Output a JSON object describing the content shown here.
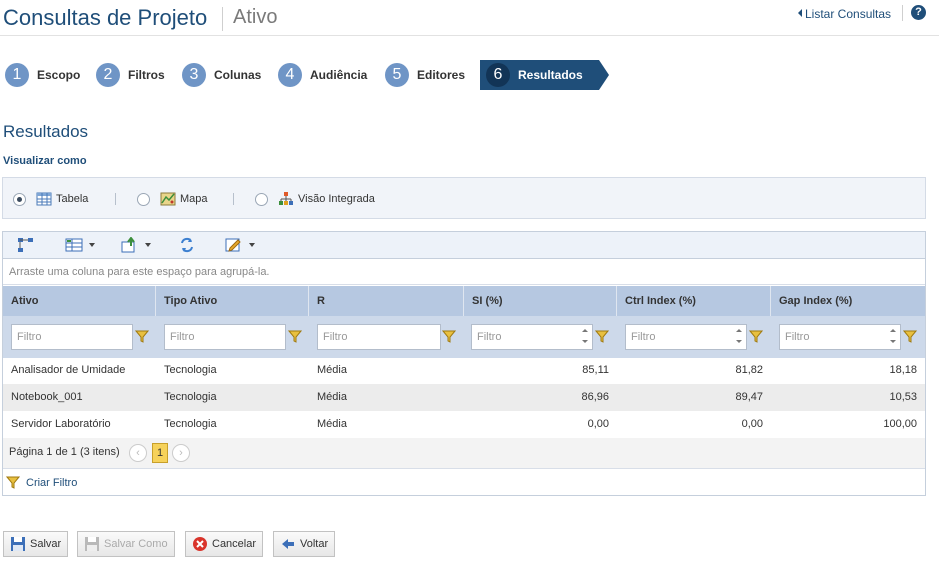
{
  "header": {
    "title": "Consultas de Projeto",
    "subtitle": "Ativo",
    "list_link": "Listar Consultas",
    "help": "?"
  },
  "steps": [
    {
      "num": "1",
      "label": "Escopo"
    },
    {
      "num": "2",
      "label": "Filtros"
    },
    {
      "num": "3",
      "label": "Colunas"
    },
    {
      "num": "4",
      "label": "Audiência"
    },
    {
      "num": "5",
      "label": "Editores"
    },
    {
      "num": "6",
      "label": "Resultados",
      "active": true
    }
  ],
  "section_title": "Resultados",
  "view_as": {
    "label": "Visualizar como",
    "options": [
      {
        "label": "Tabela",
        "checked": true,
        "icon": "table-icon"
      },
      {
        "label": "Mapa",
        "checked": false,
        "icon": "map-icon"
      },
      {
        "label": "Visão Integrada",
        "checked": false,
        "icon": "hierarchy-icon"
      }
    ]
  },
  "grid": {
    "toolbar_icons": [
      "hierarchy-icon",
      "columns-icon",
      "export-icon",
      "refresh-icon",
      "edit-icon"
    ],
    "group_hint": "Arraste uma coluna para este espaço para agrupá-la.",
    "columns": [
      "Ativo",
      "Tipo Ativo",
      "R",
      "SI (%)",
      "Ctrl Index (%)",
      "Gap Index (%)"
    ],
    "filter_placeholder": "Filtro",
    "rows": [
      [
        "Analisador de Umidade",
        "Tecnologia",
        "Média",
        "85,11",
        "81,82",
        "18,18"
      ],
      [
        "Notebook_001",
        "Tecnologia",
        "Média",
        "86,96",
        "89,47",
        "10,53"
      ],
      [
        "Servidor Laboratório",
        "Tecnologia",
        "Média",
        "0,00",
        "0,00",
        "100,00"
      ]
    ],
    "pager_text": "Página 1 de 1 (3 itens)",
    "current_page": "1",
    "prev": "‹",
    "next": "›",
    "create_filter": "Criar Filtro"
  },
  "buttons": {
    "save": "Salvar",
    "save_as": "Salvar Como",
    "cancel": "Cancelar",
    "back": "Voltar"
  },
  "colors": {
    "brand": "#1f4e79",
    "step_circle": "#6f95c6",
    "header_row": "#b6c8e1",
    "filter_row": "#cdd9ea",
    "funnel": "#e8a92b",
    "page_active": "#f6d25b"
  }
}
